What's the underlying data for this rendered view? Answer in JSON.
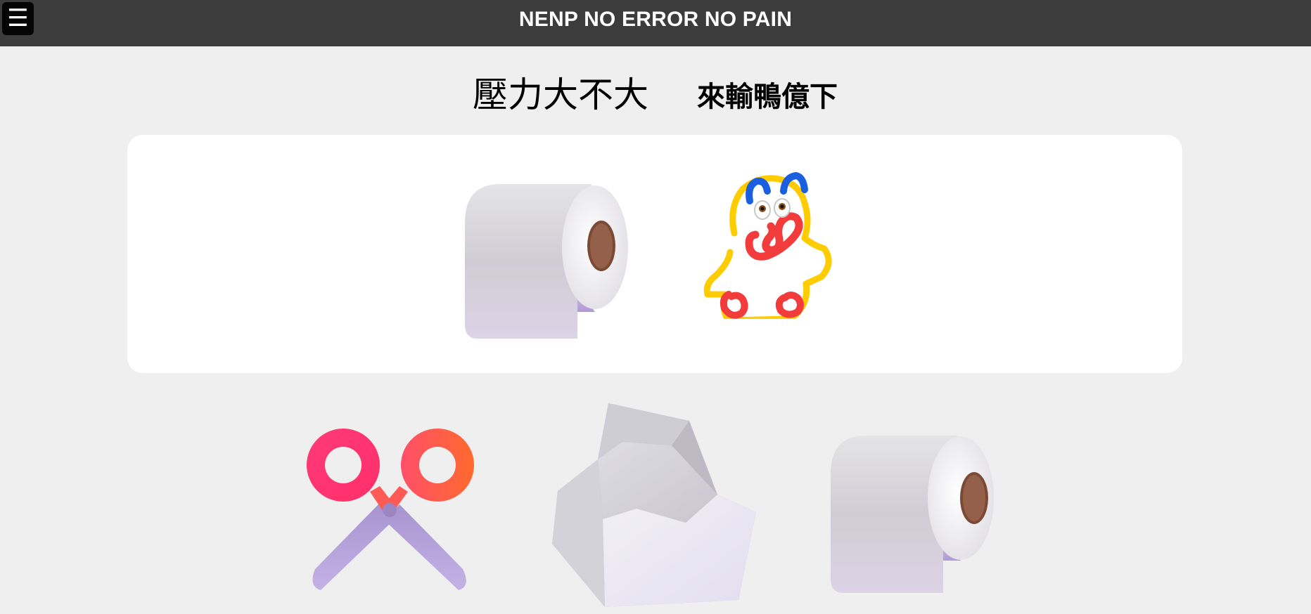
{
  "header": {
    "menu_icon": "hamburger-icon",
    "menu_glyph": "☰",
    "title": "NENP NO ERROR NO PAIN",
    "background": "#3c3c3c"
  },
  "headings": {
    "left": "壓力大不大",
    "right": "來輸鴨億下"
  },
  "card": {
    "items": [
      {
        "icon": "toilet-paper-icon"
      },
      {
        "icon": "doodle-duck-icon"
      }
    ]
  },
  "choices": [
    {
      "icon": "scissors-icon"
    },
    {
      "icon": "rock-icon"
    },
    {
      "icon": "toilet-paper-icon"
    }
  ],
  "colors": {
    "page_background": "#efefef",
    "card_background": "#ffffff",
    "duck_outline": "#ffcc00",
    "duck_red": "#f23b3b",
    "duck_blue": "#1a5fe0"
  }
}
